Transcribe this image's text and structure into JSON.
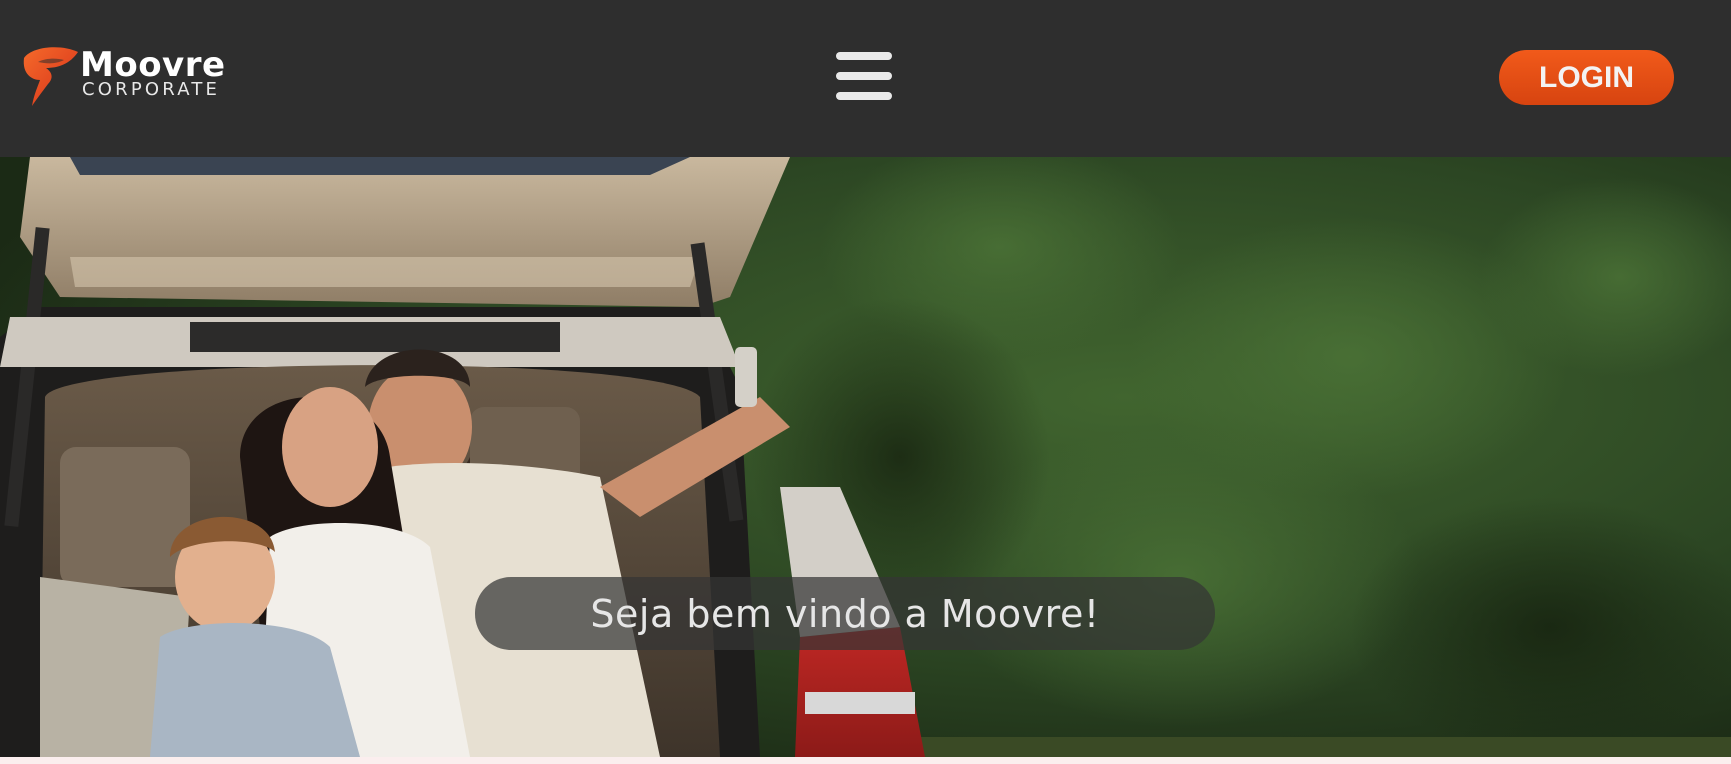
{
  "header": {
    "logo": {
      "name": "Moovre",
      "subtitle": "CORPORATE"
    },
    "menu_icon": "hamburger-menu-icon",
    "login_label": "LOGIN"
  },
  "hero": {
    "welcome_text": "Seja bem vindo a Moovre!"
  },
  "colors": {
    "header_bg": "#2e2e2e",
    "accent": "#e8501a",
    "hero_foliage": "#2c4a24"
  }
}
